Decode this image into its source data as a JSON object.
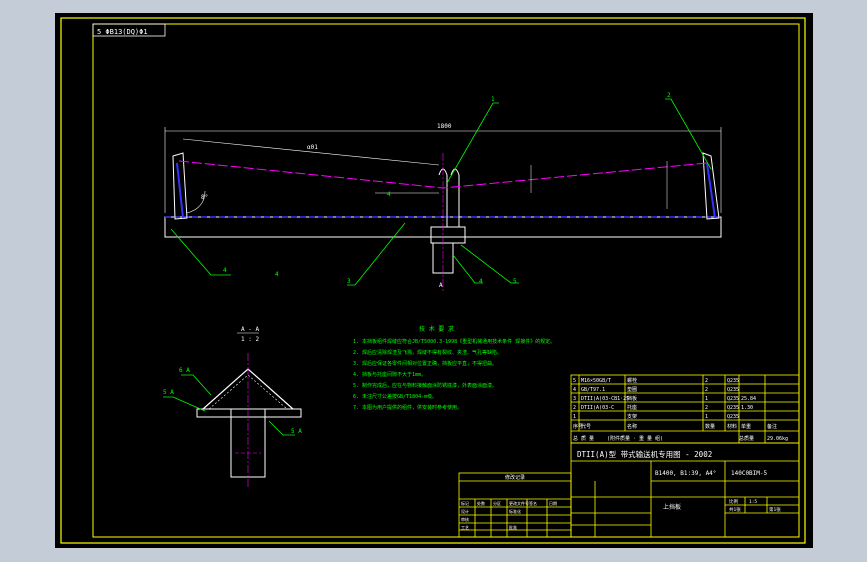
{
  "header": {
    "drawing_code": "5 ΦB13(DQ)Φ1"
  },
  "main_view": {
    "overall_dimension": "1800",
    "slope_dimension": "α01",
    "angle_label": "8°",
    "callouts": [
      "1",
      "2",
      "3",
      "4",
      "5"
    ],
    "weld_symbols": [
      "4",
      "4",
      "4"
    ],
    "center_mark": "A"
  },
  "section_view": {
    "title": "A - A",
    "scale": "1 : 2",
    "weld_labels": [
      "6 A",
      "5 A",
      "5 A"
    ]
  },
  "technical_requirements": {
    "heading": "技 术 要 求",
    "items": [
      "1. 本挡板组件焊缝应符合JB/T5000.3-1998《重型机械通用技术条件 焊接件》的规定。",
      "2. 焊后应清除焊渣及飞溅，焊缝不得有裂纹、夹渣、气孔等缺陷。",
      "3. 焊后应保证各零件间相对位置正确，挡板应平直，不得扭曲。",
      "4. 挡板与托座间隙不大于1mm。",
      "5. 制作完成后，应在与物料接触面涂防锈底漆，外表面涂面漆。",
      "6. 未注尺寸公差按GB/T1804-m级。",
      "7. 本图为用户提供的组件，供安装时参考使用。"
    ]
  },
  "parts_list": {
    "rows": [
      [
        "5",
        "M16×50GB/T",
        "螺栓",
        "2",
        "Q235",
        "",
        ""
      ],
      [
        "4",
        "GB/T97.1",
        "垫圈",
        "2",
        "Q235",
        "",
        ""
      ],
      [
        "3",
        "DTII(A)03-CB1·25",
        "挡板",
        "1",
        "Q235",
        "25.84",
        ""
      ],
      [
        "2",
        "DTII(A)03-C",
        "托座",
        "2",
        "Q235",
        "1.30",
        ""
      ],
      [
        "1",
        "",
        "支架",
        "1",
        "Q235",
        "",
        ""
      ]
    ],
    "header": [
      "序号",
      "代号",
      "名称",
      "数量",
      "材料",
      "单重",
      "备注"
    ],
    "footer": [
      "总 质 量",
      "(附件质量 · 重 量 组)",
      "",
      "总质量",
      "29.06kg"
    ]
  },
  "title_block": {
    "series_title": "DTII(A)型 带式输送机专用图 - 2002",
    "spec": "B1400, B1:39, A4°",
    "drawing_number": "140C0BIM-5",
    "part_name": "上挡板",
    "sheet_info": [
      "比例",
      "1:5",
      "共1张",
      "第1张"
    ]
  },
  "revision_block": {
    "heading": "修改记录",
    "rows": [
      [
        "标记",
        "处数",
        "分区",
        "更改文件号",
        "签名",
        "日期"
      ],
      [
        "设计",
        "",
        "",
        "标准化",
        "",
        ""
      ],
      [
        "审核",
        "",
        "",
        "",
        "",
        ""
      ],
      [
        "工艺",
        "",
        "",
        "批准",
        "",
        ""
      ]
    ]
  },
  "colors": {
    "frame": "#ffff00",
    "geometry": "#ffffff",
    "leader": "#00ff00",
    "centerline": "#ff00ff",
    "hidden": "#3333ff",
    "text": "#00ff00"
  }
}
